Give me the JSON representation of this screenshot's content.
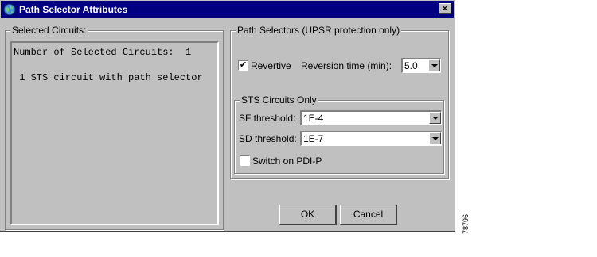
{
  "window": {
    "title": "Path Selector Attributes",
    "close_glyph": "×"
  },
  "selected_circuits": {
    "group_label": "Selected Circuits:",
    "lines": [
      "Number of Selected Circuits:  1",
      "",
      " 1 STS circuit with path selector"
    ]
  },
  "path_selectors": {
    "group_label": "Path Selectors (UPSR protection only)",
    "revertive": {
      "label": "Revertive",
      "checked": true,
      "check_glyph": "✔"
    },
    "reversion_time": {
      "label": "Reversion time (min):",
      "value": "5.0"
    },
    "sts_circuits_only": {
      "group_label": "STS Circuits Only",
      "sf_threshold": {
        "label": "SF threshold:",
        "value": "1E-4"
      },
      "sd_threshold": {
        "label": "SD threshold:",
        "value": "1E-7"
      },
      "switch_on_pdi_p": {
        "label": "Switch on PDI-P",
        "checked": false
      }
    }
  },
  "buttons": {
    "ok": "OK",
    "cancel": "Cancel"
  },
  "figure_number": "78796",
  "colors": {
    "titlebar": "#000080",
    "face": "#c0c0c0"
  },
  "icons": {
    "title": "globe-icon",
    "close": "close-icon"
  }
}
